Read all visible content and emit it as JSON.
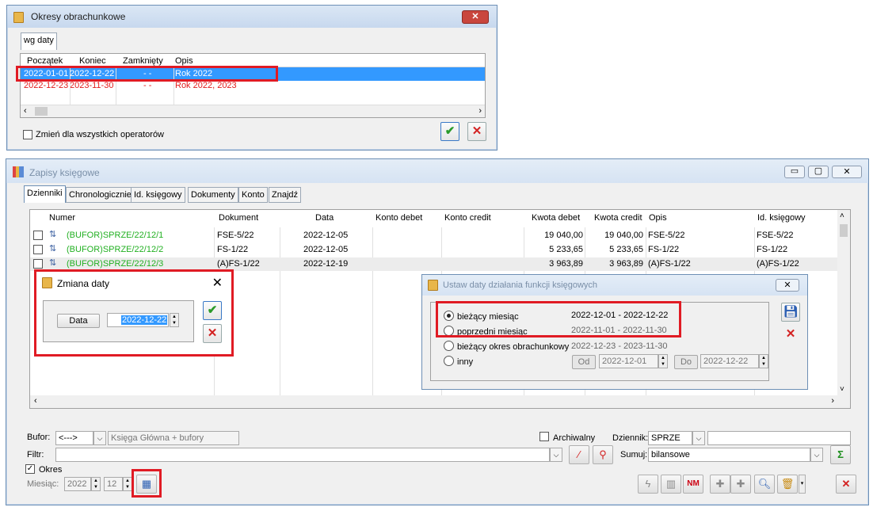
{
  "okresy_window": {
    "title": "Okresy obrachunkowe",
    "tab": "wg daty",
    "columns": [
      "Początek",
      "Koniec",
      "Zamknięty",
      "Opis"
    ],
    "rows": [
      {
        "start": "2022-01-01",
        "end": "2022-12-22",
        "closed": "- -",
        "desc": "Rok 2022"
      },
      {
        "start": "2022-12-23",
        "end": "2023-11-30",
        "closed": "- -",
        "desc": "Rok 2022, 2023"
      }
    ],
    "checkbox_label": "Zmień dla wszystkich operatorów"
  },
  "zapisy_window": {
    "title": "Zapisy księgowe",
    "tabs": [
      "Dzienniki",
      "Chronologicznie",
      "Id. księgowy",
      "Dokumenty",
      "Konto",
      "Znajdź"
    ],
    "columns": [
      "Numer",
      "Dokument",
      "Data",
      "Konto debet",
      "Konto credit",
      "Kwota debet",
      "Kwota credit",
      "Opis",
      "Id. księgowy"
    ],
    "rows": [
      {
        "numer": "(BUFOR)SPRZE/22/12/1",
        "dokument": "FSE-5/22",
        "data": "2022-12-05",
        "debet": "19 040,00",
        "credit": "19 040,00",
        "opis": "FSE-5/22",
        "id": "FSE-5/22"
      },
      {
        "numer": "(BUFOR)SPRZE/22/12/2",
        "dokument": "FS-1/22",
        "data": "2022-12-05",
        "debet": "5 233,65",
        "credit": "5 233,65",
        "opis": "FS-1/22",
        "id": "FS-1/22"
      },
      {
        "numer": "(BUFOR)SPRZE/22/12/3",
        "dokument": "(A)FS-1/22",
        "data": "2022-12-19",
        "debet": "3 963,89",
        "credit": "3 963,89",
        "opis": "(A)FS-1/22",
        "id": "(A)FS-1/22"
      }
    ],
    "bufor_label": "Bufor:",
    "bufor_value": "<--->",
    "bufor_desc": "Księga Główna + bufory",
    "archiwalny_label": "Archiwalny",
    "dziennik_label": "Dziennik:",
    "dziennik_value": "SPRZE",
    "filtr_label": "Filtr:",
    "sumuj_label": "Sumuj:",
    "sumuj_value": "bilansowe",
    "okres_label": "Okres",
    "miesiac_label": "Miesiąc:",
    "year_value": "2022",
    "month_value": "12"
  },
  "zmiana_daty": {
    "title": "Zmiana daty",
    "button": "Data",
    "value": "2022-12-22"
  },
  "ustaw_daty": {
    "title": "Ustaw daty działania funkcji księgowych",
    "options": [
      {
        "label": "bieżący miesiąc",
        "range": "2022-12-01 - 2022-12-22"
      },
      {
        "label": "poprzedni miesiąc",
        "range": "2022-11-01 - 2022-11-30"
      },
      {
        "label": "bieżący okres obrachunkowy",
        "range": "2022-12-23 - 2023-11-30"
      },
      {
        "label": "inny",
        "range": ""
      }
    ],
    "od_label": "Od",
    "od_value": "2022-12-01",
    "do_label": "Do",
    "do_value": "2022-12-22"
  },
  "colors": {
    "accent": "#3399ff",
    "highlight_red": "#e01b24",
    "bufor_green": "#22b022",
    "row_red": "#e21d1d"
  }
}
